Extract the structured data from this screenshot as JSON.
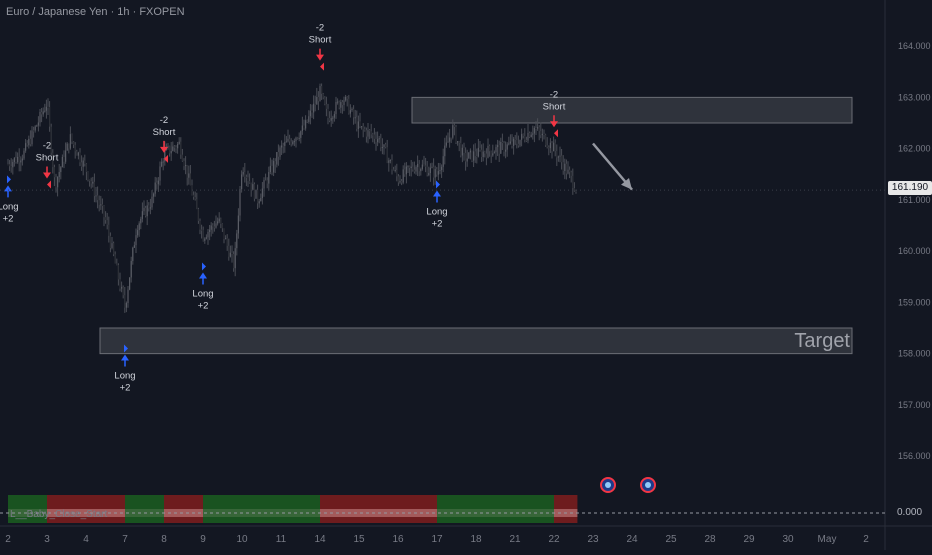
{
  "header": {
    "symbol_title": "Euro / Japanese Yen · 1h · FXOPEN"
  },
  "price_axis": {
    "ticks": [
      "164.000",
      "163.000",
      "162.000",
      "161.000",
      "160.000",
      "159.000",
      "158.000",
      "157.000",
      "156.000"
    ],
    "last_price": "161.190",
    "indicator_value": "0.000"
  },
  "time_axis": {
    "ticks": [
      "2",
      "3",
      "4",
      "7",
      "8",
      "9",
      "10",
      "11",
      "14",
      "15",
      "16",
      "17",
      "18",
      "21",
      "22",
      "23",
      "24",
      "25",
      "28",
      "29",
      "30",
      "May",
      "2"
    ]
  },
  "zones": {
    "target_label": "Target"
  },
  "indicator": {
    "label": "L__Baby_Close_Start",
    "value": "0.000",
    "colors": {
      "bull": "#1b5e20",
      "bear": "#7f1d1d"
    },
    "segments": [
      {
        "state": "bull",
        "from": "2",
        "to": "3"
      },
      {
        "state": "bear",
        "from": "3",
        "to": "7"
      },
      {
        "state": "bull",
        "from": "7",
        "to": "8"
      },
      {
        "state": "bear",
        "from": "8",
        "to": "9"
      },
      {
        "state": "bull",
        "from": "9",
        "to": "14"
      },
      {
        "state": "bear",
        "from": "14",
        "to": "17"
      },
      {
        "state": "bull",
        "from": "17",
        "to": "22"
      },
      {
        "state": "bear",
        "from": "22",
        "to": "22.6"
      }
    ]
  },
  "signals": [
    {
      "type": "long",
      "line1": "Long",
      "line2": "+2",
      "date": "2",
      "price": 161.4
    },
    {
      "type": "short",
      "line1": "-2",
      "line2": "Short",
      "date": "3",
      "price": 161.3
    },
    {
      "type": "long",
      "line1": "Long",
      "line2": "+2",
      "date": "7",
      "price": 158.1
    },
    {
      "type": "short",
      "line1": "-2",
      "line2": "Short",
      "date": "8",
      "price": 161.8
    },
    {
      "type": "long",
      "line1": "Long",
      "line2": "+2",
      "date": "9",
      "price": 159.7
    },
    {
      "type": "short",
      "line1": "-2",
      "line2": "Short",
      "date": "14",
      "price": 163.6
    },
    {
      "type": "long",
      "line1": "Long",
      "line2": "+2",
      "date": "17",
      "price": 161.3
    },
    {
      "type": "short",
      "line1": "-2",
      "line2": "Short",
      "date": "22",
      "price": 162.3
    }
  ],
  "chart_data": {
    "type": "candlestick",
    "symbol": "Euro / Japanese Yen",
    "interval": "1h",
    "source": "FXOPEN",
    "ylim": [
      155.3,
      164.9
    ],
    "x_categories": [
      "2",
      "3",
      "4",
      "7",
      "8",
      "9",
      "10",
      "11",
      "14",
      "15",
      "16",
      "17",
      "18",
      "21",
      "22",
      "23",
      "24",
      "25",
      "28",
      "29",
      "30",
      "May",
      "2"
    ],
    "last_price": 161.19,
    "close_path": [
      {
        "x": "2",
        "y": 161.7
      },
      {
        "x": "2.4",
        "y": 161.9
      },
      {
        "x": "3",
        "y": 162.9
      },
      {
        "x": "3.2",
        "y": 161.3
      },
      {
        "x": "3.6",
        "y": 162.2
      },
      {
        "x": "4",
        "y": 161.6
      },
      {
        "x": "4.5",
        "y": 160.6
      },
      {
        "x": "7",
        "y": 158.9
      },
      {
        "x": "7.3",
        "y": 160.5
      },
      {
        "x": "7.7",
        "y": 161.0
      },
      {
        "x": "8",
        "y": 161.9
      },
      {
        "x": "8.4",
        "y": 162.1
      },
      {
        "x": "8.7",
        "y": 161.2
      },
      {
        "x": "9",
        "y": 160.3
      },
      {
        "x": "9.4",
        "y": 160.6
      },
      {
        "x": "9.8",
        "y": 159.7
      },
      {
        "x": "10",
        "y": 161.7
      },
      {
        "x": "10.4",
        "y": 161.0
      },
      {
        "x": "11",
        "y": 162.0
      },
      {
        "x": "11.6",
        "y": 162.4
      },
      {
        "x": "14",
        "y": 163.1
      },
      {
        "x": "14.2",
        "y": 162.6
      },
      {
        "x": "14.6",
        "y": 163.0
      },
      {
        "x": "15",
        "y": 162.4
      },
      {
        "x": "15.5",
        "y": 162.2
      },
      {
        "x": "16",
        "y": 161.4
      },
      {
        "x": "16.5",
        "y": 161.7
      },
      {
        "x": "17",
        "y": 161.5
      },
      {
        "x": "17.4",
        "y": 162.4
      },
      {
        "x": "17.7",
        "y": 161.8
      },
      {
        "x": "18",
        "y": 161.9
      },
      {
        "x": "18.6",
        "y": 162.0
      },
      {
        "x": "21",
        "y": 162.1
      },
      {
        "x": "21.5",
        "y": 162.4
      },
      {
        "x": "22",
        "y": 162.0
      },
      {
        "x": "22.3",
        "y": 161.6
      },
      {
        "x": "22.6",
        "y": 161.19
      }
    ],
    "zones": [
      {
        "name": "Target",
        "x_from": "7",
        "x_to": "30",
        "y_from": 158.0,
        "y_to": 158.5
      },
      {
        "name": "",
        "x_from": "17",
        "x_to": "30",
        "y_from": 162.5,
        "y_to": 163.0
      }
    ],
    "projection": {
      "from": {
        "x": "23",
        "y": 162.1
      },
      "to": {
        "x": "24",
        "y": 161.2
      }
    }
  }
}
